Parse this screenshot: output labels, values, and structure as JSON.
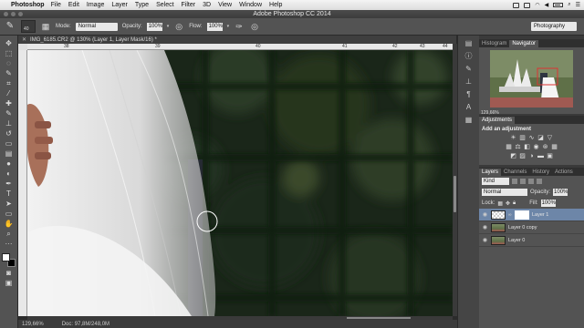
{
  "menubar": {
    "app": "Photoshop",
    "items": [
      "File",
      "Edit",
      "Image",
      "Layer",
      "Type",
      "Select",
      "Filter",
      "3D",
      "View",
      "Window",
      "Help"
    ],
    "battery": "",
    "time": ""
  },
  "window": {
    "title": "Adobe Photoshop CC 2014"
  },
  "options": {
    "brush_size": "40",
    "mode_label": "Mode:",
    "mode_value": "Normal",
    "opacity_label": "Opacity:",
    "opacity_value": "100%",
    "flow_label": "Flow:",
    "flow_value": "100%",
    "workspace": "Photography"
  },
  "document": {
    "tab_label": "IMG_6185.CR2 @ 130% (Layer 1, Layer Mask/16) *",
    "ruler_labels": [
      "38",
      "39",
      "40",
      "41",
      "42",
      "43",
      "44"
    ],
    "status_zoom": "129,66%",
    "status_doc": "Doc: 97,8M/248,0M"
  },
  "panels": {
    "nav_tabs": [
      "Histogram",
      "Navigator"
    ],
    "nav_zoom": "129,66%",
    "adjust_tab": "Adjustments",
    "adjust_title": "Add an adjustment",
    "layer_tabs": [
      "Layers",
      "Channels",
      "History",
      "Actions"
    ],
    "kind_label": "Kind",
    "blend_mode": "Normal",
    "opacity_label": "Opacity:",
    "opacity_value": "100%",
    "lock_label": "Lock:",
    "fill_label": "Fill:",
    "fill_value": "100%",
    "layers": [
      "Layer 1",
      "Layer 0 copy",
      "Layer 0"
    ]
  },
  "colors": {
    "accent_selected_layer": "#6d86a8",
    "canvas_bg": "#1c2a1c"
  }
}
